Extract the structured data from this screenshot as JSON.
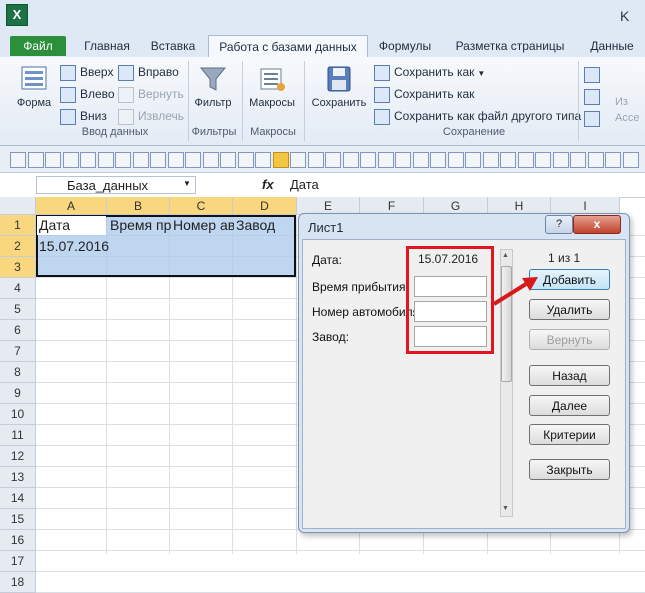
{
  "window": {
    "logo": "X",
    "title_fragment": "K"
  },
  "tabs": [
    "Файл",
    "Главная",
    "Вставка",
    "Работа с базами данных",
    "Формулы",
    "Разметка страницы",
    "Данные"
  ],
  "ribbon": {
    "groups": {
      "input": "Ввод данных",
      "filters": "Фильтры",
      "macros": "Макросы",
      "save": "Сохранение"
    },
    "buttons": {
      "form": "Форма",
      "up": "Вверх",
      "left": "Влево",
      "down": "Вниз",
      "right": "Вправо",
      "revert": "Вернуть",
      "extract": "Извлечь",
      "filter": "Фильтр",
      "macros": "Макросы",
      "save": "Сохранить",
      "save_as1": "Сохранить как",
      "save_as2": "Сохранить как",
      "save_as_other": "Сохранить как файл другого типа",
      "right_frag1": "Из",
      "right_frag2": "Acce"
    }
  },
  "formula_bar": {
    "name_box": "База_данных",
    "fx": "fx",
    "content": "Дата"
  },
  "sheet": {
    "columns": [
      "A",
      "B",
      "C",
      "D",
      "E",
      "F",
      "G",
      "H",
      "I"
    ],
    "rows": [
      "1",
      "2",
      "3",
      "4",
      "5",
      "6",
      "7",
      "8",
      "9",
      "10",
      "11",
      "12",
      "13",
      "14",
      "15",
      "16",
      "17",
      "18"
    ],
    "cells": {
      "a1": "Дата",
      "b1": "Время пр",
      "c1": "Номер ав",
      "d1": "Завод",
      "a2": "15.07.2016"
    }
  },
  "dialog": {
    "title": "Лист1",
    "help": "?",
    "close": "x",
    "record_counter": "1 из 1",
    "fields": {
      "date_label": "Дата:",
      "date_value": "15.07.2016",
      "arrival_label": "Время прибытия:",
      "car_label": "Номер автомобиля:",
      "plant_label": "Завод:"
    },
    "buttons": {
      "add": "Добавить",
      "delete": "Удалить",
      "restore": "Вернуть",
      "back": "Назад",
      "next": "Далее",
      "criteria": "Критерии",
      "close": "Закрыть"
    }
  },
  "colors": {
    "highlight_red": "#e0151e",
    "selection_fill": "#b9d3ee",
    "excel_green": "#2b8f3c"
  }
}
